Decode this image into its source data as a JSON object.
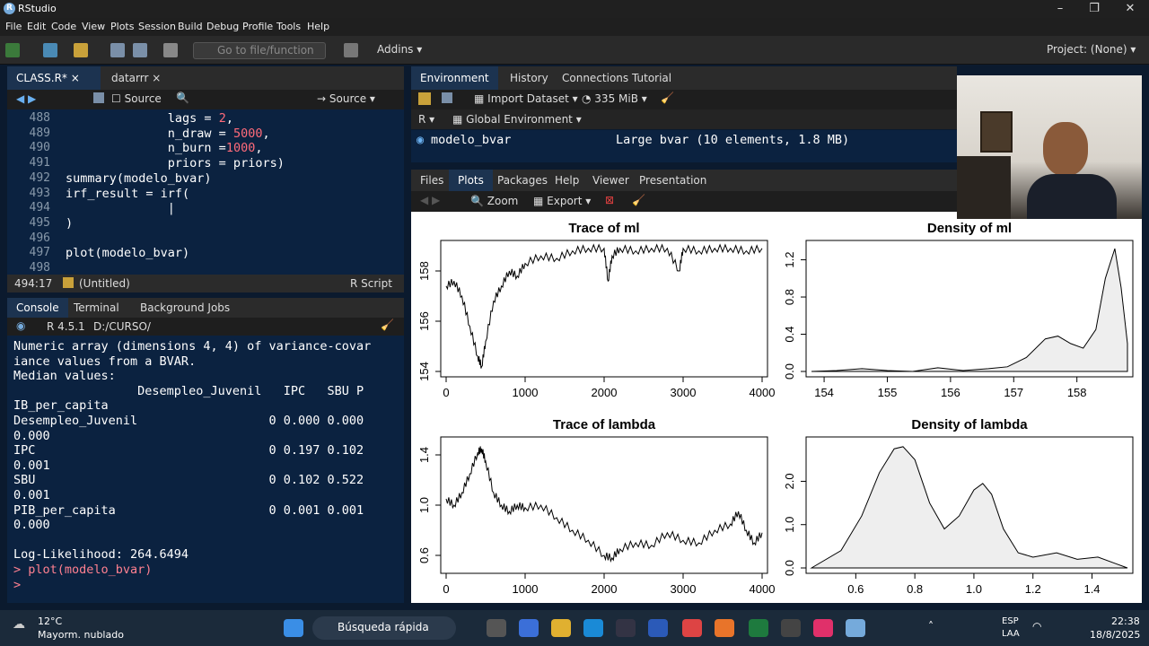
{
  "window": {
    "title": "RStudio",
    "logo": "R",
    "min": "–",
    "max": "❐",
    "close": "✕"
  },
  "menu": [
    "File",
    "Edit",
    "Code",
    "View",
    "Plots",
    "Session",
    "Build",
    "Debug",
    "Profile",
    "Tools",
    "Help"
  ],
  "toolbar": {
    "goto_placeholder": "Go to file/function",
    "addins": "Addins",
    "project": "Project: (None)"
  },
  "editor": {
    "tabs": [
      {
        "label": "CLASS.R*"
      },
      {
        "label": "datarrr"
      }
    ],
    "source_on_save": "Source",
    "source_btn": "Source",
    "lines": [
      {
        "n": "488",
        "parts": [
          [
            "t",
            "              lags = "
          ],
          [
            "n",
            "2"
          ],
          [
            "t",
            ","
          ]
        ]
      },
      {
        "n": "489",
        "parts": [
          [
            "t",
            "              n_draw = "
          ],
          [
            "n",
            "5000"
          ],
          [
            "t",
            ","
          ]
        ]
      },
      {
        "n": "490",
        "parts": [
          [
            "t",
            "              n_burn ="
          ],
          [
            "n",
            "1000"
          ],
          [
            "t",
            ","
          ]
        ]
      },
      {
        "n": "491",
        "parts": [
          [
            "t",
            "              priors = priors)"
          ]
        ]
      },
      {
        "n": "492",
        "parts": [
          [
            "t",
            "summary(modelo_bvar)"
          ]
        ]
      },
      {
        "n": "493",
        "parts": [
          [
            "t",
            "irf_result = irf("
          ]
        ]
      },
      {
        "n": "494",
        "parts": [
          [
            "t",
            "              |"
          ]
        ]
      },
      {
        "n": "495",
        "parts": [
          [
            "t",
            ")"
          ]
        ]
      },
      {
        "n": "496",
        "parts": [
          [
            "t",
            ""
          ]
        ]
      },
      {
        "n": "497",
        "parts": [
          [
            "t",
            "plot(modelo_bvar)"
          ]
        ]
      },
      {
        "n": "498",
        "parts": [
          [
            "t",
            ""
          ]
        ]
      }
    ],
    "status_pos": "494:17",
    "status_scope": "(Untitled)",
    "status_type": "R Script"
  },
  "console": {
    "tabs": [
      "Console",
      "Terminal",
      "Background Jobs"
    ],
    "r_version": "R 4.5.1",
    "path": "D:/CURSO/",
    "lines": [
      "Numeric array (dimensions 4, 4) of variance-covar",
      "iance values from a BVAR.",
      "Median values:",
      "                 Desempleo_Juvenil   IPC   SBU P",
      "IB_per_capita",
      "Desempleo_Juvenil                  0 0.000 0.000",
      "0.000",
      "IPC                                0 0.197 0.102",
      "0.001",
      "SBU                                0 0.102 0.522",
      "0.001",
      "PIB_per_capita                     0 0.001 0.001",
      "0.000",
      "",
      "Log-Likelihood: 264.6494"
    ],
    "cmd": "> plot(modelo_bvar)",
    "prompt": "> "
  },
  "env": {
    "tabs": [
      "Environment",
      "History",
      "Connections",
      "Tutorial"
    ],
    "import": "Import Dataset",
    "memory": "335 MiB",
    "lang": "R",
    "scope": "Global Environment",
    "row_name": "modelo_bvar",
    "row_value": "Large bvar (10 elements, 1.8 MB)"
  },
  "files": {
    "tabs": [
      "Files",
      "Plots",
      "Packages",
      "Help",
      "Viewer",
      "Presentation"
    ],
    "zoom": "Zoom",
    "export": "Export"
  },
  "chart_data": [
    {
      "type": "line",
      "title": "Trace of ml",
      "xlim": [
        0,
        4000
      ],
      "ylim": [
        154,
        159
      ],
      "xticks": [
        "0",
        "1000",
        "2000",
        "3000",
        "4000"
      ],
      "yticks": [
        "154",
        "156",
        "158"
      ],
      "x": [
        0,
        100,
        200,
        300,
        400,
        450,
        500,
        600,
        700,
        800,
        900,
        1000,
        1200,
        1400,
        1600,
        1800,
        2000,
        2050,
        2100,
        2200,
        2400,
        2600,
        2800,
        2950,
        3000,
        3200,
        3400,
        3600,
        3800,
        4000
      ],
      "values": [
        157.4,
        157.6,
        157.0,
        155.8,
        154.6,
        154.2,
        155.2,
        156.8,
        157.4,
        158.0,
        157.8,
        158.3,
        158.6,
        158.5,
        158.8,
        158.9,
        158.9,
        157.6,
        158.6,
        158.9,
        158.8,
        158.9,
        158.9,
        158.0,
        158.9,
        158.8,
        158.9,
        158.9,
        158.8,
        158.9
      ]
    },
    {
      "type": "area",
      "title": "Density of ml",
      "xlim": [
        153.8,
        158.8
      ],
      "ylim": [
        0,
        1.35
      ],
      "xticks": [
        "154",
        "155",
        "156",
        "157",
        "158"
      ],
      "yticks": [
        "0.0",
        "0.4",
        "0.8",
        "1.2"
      ],
      "x": [
        153.8,
        154.2,
        154.6,
        155.0,
        155.4,
        155.8,
        156.2,
        156.6,
        156.9,
        157.2,
        157.5,
        157.7,
        157.9,
        158.1,
        158.3,
        158.45,
        158.6,
        158.7,
        158.8
      ],
      "values": [
        0.0,
        0.01,
        0.03,
        0.01,
        0.0,
        0.04,
        0.01,
        0.03,
        0.05,
        0.15,
        0.35,
        0.38,
        0.3,
        0.25,
        0.45,
        1.0,
        1.32,
        0.9,
        0.3
      ]
    },
    {
      "type": "line",
      "title": "Trace of lambda",
      "xlim": [
        0,
        4000
      ],
      "ylim": [
        0.5,
        1.5
      ],
      "xticks": [
        "0",
        "1000",
        "2000",
        "3000",
        "4000"
      ],
      "yticks": [
        "0.6",
        "1.0",
        "1.4"
      ],
      "x": [
        0,
        100,
        200,
        300,
        400,
        450,
        500,
        600,
        700,
        800,
        900,
        1000,
        1200,
        1400,
        1600,
        1800,
        2000,
        2100,
        2200,
        2400,
        2600,
        2800,
        3000,
        3200,
        3400,
        3600,
        3700,
        3800,
        3900,
        4000
      ],
      "values": [
        1.05,
        1.0,
        1.1,
        1.25,
        1.42,
        1.45,
        1.35,
        1.1,
        1.0,
        0.95,
        1.0,
        0.98,
        1.0,
        0.9,
        0.8,
        0.72,
        0.6,
        0.58,
        0.65,
        0.7,
        0.68,
        0.78,
        0.72,
        0.7,
        0.8,
        0.85,
        0.95,
        0.8,
        0.7,
        0.78
      ]
    },
    {
      "type": "area",
      "title": "Density of lambda",
      "xlim": [
        0.45,
        1.52
      ],
      "ylim": [
        0,
        2.9
      ],
      "xticks": [
        "0.6",
        "0.8",
        "1.0",
        "1.2",
        "1.4"
      ],
      "yticks": [
        "0.0",
        "1.0",
        "2.0"
      ],
      "x": [
        0.45,
        0.55,
        0.62,
        0.68,
        0.73,
        0.76,
        0.8,
        0.85,
        0.9,
        0.95,
        1.0,
        1.03,
        1.06,
        1.1,
        1.15,
        1.2,
        1.28,
        1.35,
        1.42,
        1.48,
        1.52
      ],
      "values": [
        0.0,
        0.4,
        1.2,
        2.2,
        2.75,
        2.8,
        2.5,
        1.5,
        0.9,
        1.2,
        1.8,
        1.95,
        1.7,
        0.9,
        0.35,
        0.25,
        0.35,
        0.2,
        0.25,
        0.1,
        0.0
      ]
    }
  ],
  "taskbar": {
    "temp": "12°C",
    "weather": "Mayorm. nublado",
    "search": "Búsqueda rápida",
    "lang1": "ESP",
    "lang2": "LAA",
    "time": "22:38",
    "date": "18/8/2025"
  }
}
